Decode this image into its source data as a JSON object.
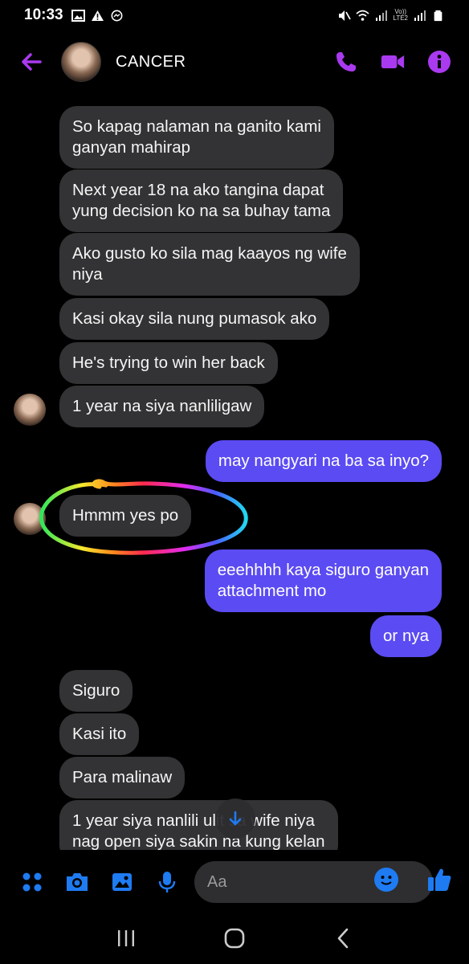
{
  "status_bar": {
    "time": "10:33",
    "network_label_top": "Vo))",
    "network_label_bottom": "LTE2"
  },
  "header": {
    "contact_name": "CANCER",
    "accent_color": "#a93af0"
  },
  "messages": [
    {
      "sender": "contact",
      "text": "So kapag nalaman na ganito kami\nganyan mahirap"
    },
    {
      "sender": "contact",
      "text": "Next year 18 na ako tangina dapat\nyung decision ko na sa buhay tama"
    },
    {
      "sender": "contact",
      "text": "Ako gusto ko sila mag kaayos ng wife\nniya"
    },
    {
      "sender": "contact",
      "text": "Kasi okay sila nung pumasok ako"
    },
    {
      "sender": "contact",
      "text": "He's trying to win her back"
    },
    {
      "sender": "contact",
      "text": "1 year na siya nanliligaw"
    },
    {
      "sender": "me",
      "text": "may nangyari na ba sa inyo?"
    },
    {
      "sender": "contact",
      "text": "Hmmm yes po"
    },
    {
      "sender": "me",
      "text": "eeehhhh kaya siguro ganyan\nattachment mo"
    },
    {
      "sender": "me",
      "text": "or nya"
    },
    {
      "sender": "contact",
      "text": "Siguro"
    },
    {
      "sender": "contact",
      "text": "Kasi ito"
    },
    {
      "sender": "contact",
      "text": "Para malinaw"
    },
    {
      "sender": "contact",
      "text": "1 year siya nanlili     ulit sa wife niya\nnag open siya sakin na kung kelan"
    }
  ],
  "composer": {
    "placeholder": "Aa"
  },
  "colors": {
    "outgoing_bubble": "#5b4bf2",
    "incoming_bubble": "#333335",
    "messenger_blue": "#1e7bf2",
    "background": "#000000"
  },
  "icons": {
    "back": "arrow-left-icon",
    "call": "phone-icon",
    "video": "video-camera-icon",
    "info": "info-icon",
    "apps": "four-dots-icon",
    "camera": "camera-icon",
    "gallery": "image-icon",
    "mic": "microphone-icon",
    "emoji": "emoji-icon",
    "like": "thumbs-up-icon",
    "scroll": "arrow-down-icon"
  }
}
